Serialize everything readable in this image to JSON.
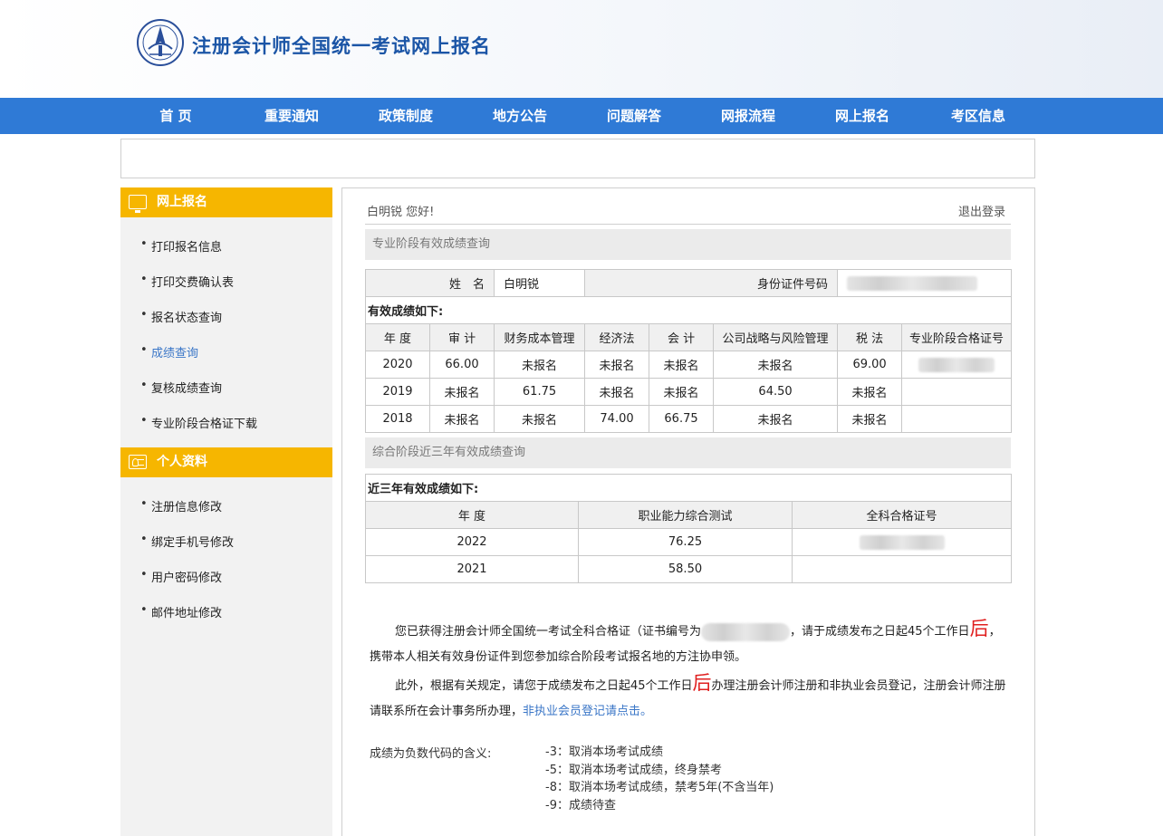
{
  "header": {
    "site_title": "注册会计师全国统一考试网上报名",
    "logo_icon": "cicpa-emblem-icon"
  },
  "nav": {
    "items": [
      "首 页",
      "重要通知",
      "政策制度",
      "地方公告",
      "问题解答",
      "网报流程",
      "网上报名",
      "考区信息"
    ]
  },
  "sidebar": {
    "section1_title": "网上报名",
    "section1_items": [
      "打印报名信息",
      "打印交费确认表",
      "报名状态查询",
      "成绩查询",
      "复核成绩查询",
      "专业阶段合格证下载"
    ],
    "section2_title": "个人资料",
    "section2_items": [
      "注册信息修改",
      "绑定手机号修改",
      "用户密码修改",
      "邮件地址修改"
    ],
    "active_item": "成绩查询"
  },
  "main": {
    "greeting": "白明锐 您好!",
    "logout": "退出登录",
    "section1_title": "专业阶段有效成绩查询",
    "name_label": "姓　名",
    "name_value": "白明锐",
    "id_label": "身份证件号码",
    "valid_scores_label": "有效成绩如下:",
    "professional_table": {
      "headers": [
        "年 度",
        "审 计",
        "财务成本管理",
        "经济法",
        "会 计",
        "公司战略与风险管理",
        "税 法",
        "专业阶段合格证号"
      ],
      "rows": [
        [
          "2020",
          "66.00",
          "未报名",
          "未报名",
          "未报名",
          "未报名",
          "69.00",
          ""
        ],
        [
          "2019",
          "未报名",
          "61.75",
          "未报名",
          "未报名",
          "64.50",
          "未报名",
          ""
        ],
        [
          "2018",
          "未报名",
          "未报名",
          "74.00",
          "66.75",
          "未报名",
          "未报名",
          ""
        ]
      ]
    },
    "section2_title": "综合阶段近三年有效成绩查询",
    "recent_scores_label": "近三年有效成绩如下:",
    "comprehensive_table": {
      "headers": [
        "年 度",
        "职业能力综合测试",
        "全科合格证号"
      ],
      "rows": [
        [
          "2022",
          "76.25",
          ""
        ],
        [
          "2021",
          "58.50",
          ""
        ]
      ]
    },
    "notice": {
      "p1_a": "您已获得注册会计师全国统一考试全科合格证（证书编号为",
      "p1_b": "，请于成绩发布之日起45个工作日",
      "p1_red": "后",
      "p1_c": "，携带本人相关有效身份证件到您参加综合阶段考试报名地的方注协申领。",
      "p2_a": "此外，根据有关规定，请您于成绩发布之日起45个工作日",
      "p2_red": "后",
      "p2_b": "办理注册会计师注册和非执业会员登记，注册会计师注册请联系所在会计事务所办理，",
      "p2_link": "非执业会员登记请点击。"
    },
    "codes_label": "成绩为负数代码的含义:",
    "codes": [
      "-3：取消本场考试成绩",
      "-5：取消本场考试成绩，终身禁考",
      "-8：取消本场考试成绩，禁考5年(不含当年)",
      "-9：成绩待查"
    ]
  },
  "colors": {
    "nav_bg": "#2f7ad6",
    "sidebar_header": "#f6b600",
    "title_blue": "#1b55a6",
    "active_link": "#3a76c7",
    "emphasis_red": "#e02020"
  }
}
